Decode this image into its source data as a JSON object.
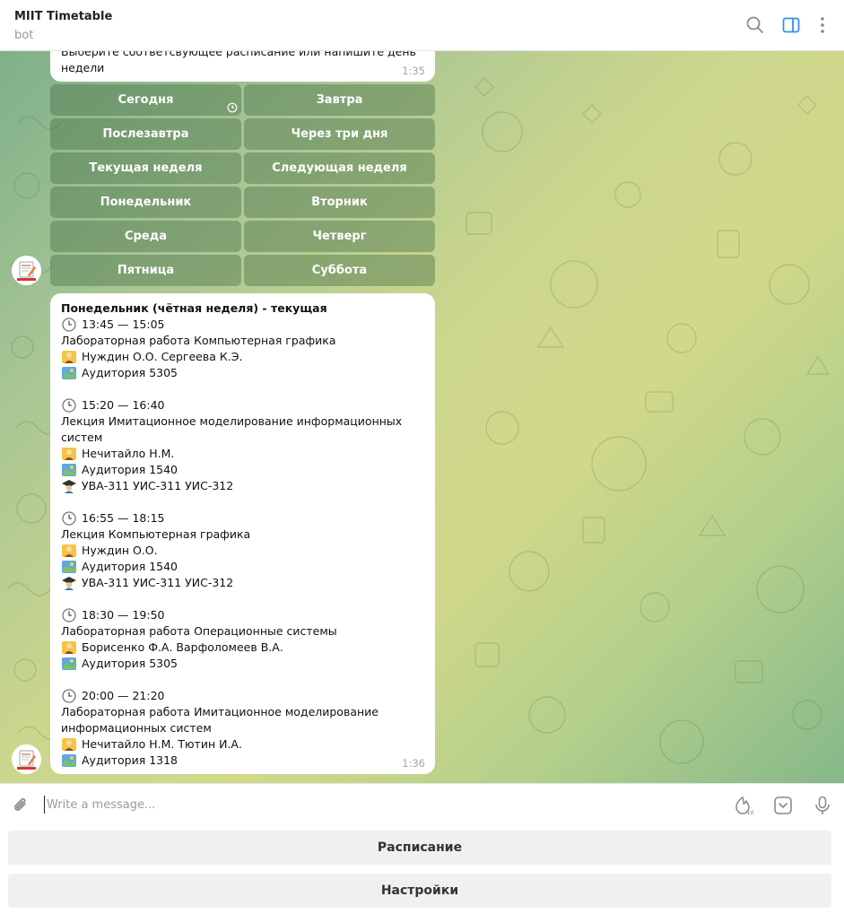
{
  "header": {
    "title": "MIIT Timetable",
    "subtitle": "bot"
  },
  "messages": {
    "prompt": {
      "text": "Выберите соответсвующее расписание или напишите день недели",
      "time": "1:35"
    },
    "keyboard": [
      "Сегодня",
      "Завтра",
      "Послезавтра",
      "Через три дня",
      "Текущая неделя",
      "Следующая неделя",
      "Понедельник",
      "Вторник",
      "Среда",
      "Четверг",
      "Пятница",
      "Суббота"
    ],
    "schedule": {
      "heading": "Понедельник (чётная неделя) - текущая",
      "lessons": [
        {
          "time": "13:45 — 15:05",
          "title": "Лабораторная работа Компьютерная графика",
          "teacher": "Нуждин О.О. Сергеева К.Э.",
          "room": "Аудитория 5305",
          "groups": ""
        },
        {
          "time": "15:20 — 16:40",
          "title": "Лекция Имитационное моделирование информационных систем",
          "teacher": "Нечитайло Н.М.",
          "room": "Аудитория 1540",
          "groups": "УВА-311 УИС-311 УИС-312"
        },
        {
          "time": "16:55 — 18:15",
          "title": "Лекция Компьютерная графика",
          "teacher": "Нуждин О.О.",
          "room": "Аудитория 1540",
          "groups": "УВА-311 УИС-311 УИС-312"
        },
        {
          "time": "18:30 — 19:50",
          "title": "Лабораторная работа Операционные системы",
          "teacher": "Борисенко Ф.А. Варфоломеев В.А.",
          "room": "Аудитория 5305",
          "groups": ""
        },
        {
          "time": "20:00 — 21:20",
          "title": "Лабораторная работа Имитационное моделирование информационных систем",
          "teacher": "Нечитайло Н.М. Тютин И.А.",
          "room": "Аудитория 1318",
          "groups": ""
        }
      ],
      "time": "1:36"
    }
  },
  "input": {
    "placeholder": "Write a message..."
  },
  "reply_keyboard": [
    "Расписание",
    "Настройки"
  ],
  "colors": {
    "accent": "#3390ec",
    "keyboard_button": "#6b8f5f"
  }
}
